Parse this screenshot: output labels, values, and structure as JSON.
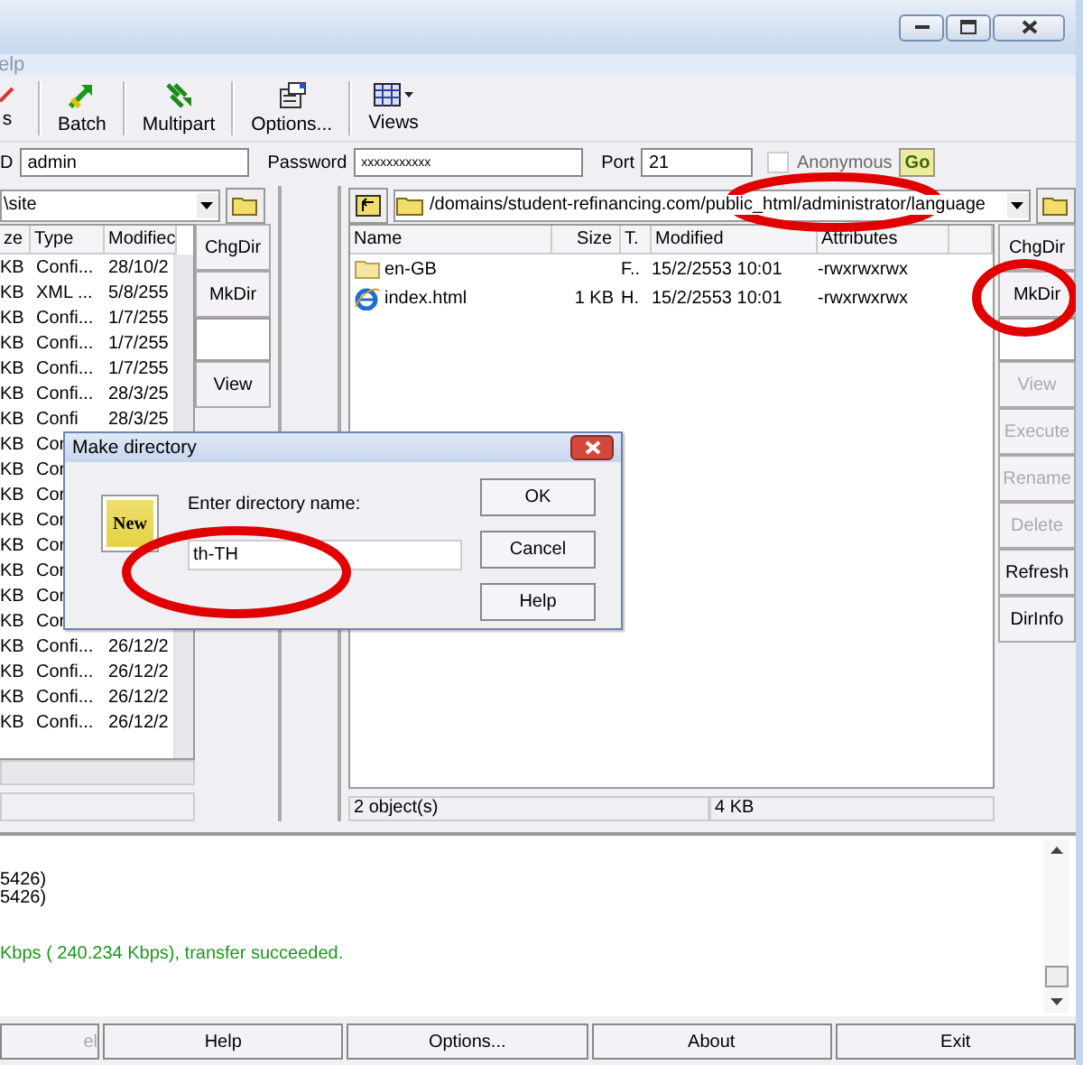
{
  "menu_bar": {
    "items": [
      "elp"
    ]
  },
  "toolbar": [
    {
      "kind": "edit",
      "label": "s"
    },
    {
      "kind": "batch",
      "label": "Batch"
    },
    {
      "kind": "multipart",
      "label": "Multipart"
    },
    {
      "kind": "options",
      "label": "Options..."
    },
    {
      "kind": "views",
      "label": "Views"
    }
  ],
  "connection": {
    "user_label": "D",
    "user": "admin",
    "password_label": "Password",
    "password": "xxxxxxxxxxx",
    "port_label": "Port",
    "port": "21",
    "anonymous": {
      "label": "Anonymous",
      "checked": false,
      "disabled": true
    },
    "go": "Go"
  },
  "local_pane": {
    "path": "\\site",
    "columns": [
      "ze",
      "Type",
      "Modifiec"
    ],
    "rows": [
      {
        "size": "KB",
        "type": "Confi...",
        "modified": "28/10/2"
      },
      {
        "size": "KB",
        "type": "XML ...",
        "modified": "5/8/255"
      },
      {
        "size": "KB",
        "type": "Confi...",
        "modified": "1/7/255"
      },
      {
        "size": "KB",
        "type": "Confi...",
        "modified": "1/7/255"
      },
      {
        "size": "KB",
        "type": "Confi...",
        "modified": "1/7/255"
      },
      {
        "size": "KB",
        "type": "Confi...",
        "modified": "28/3/25"
      },
      {
        "size": "KB",
        "type": "Confi",
        "modified": "28/3/25"
      },
      {
        "size": "KB",
        "type": "Cor"
      },
      {
        "size": "KB",
        "type": "Cor"
      },
      {
        "size": "KB",
        "type": "Cor"
      },
      {
        "size": "KB",
        "type": "Cor"
      },
      {
        "size": "KB",
        "type": "Cor"
      },
      {
        "size": "KB",
        "type": "Cor"
      },
      {
        "size": "KB",
        "type": "Cor"
      },
      {
        "size": "KB",
        "type": "Cor"
      },
      {
        "size": "KB",
        "type": "Confi...",
        "modified": "26/12/2"
      },
      {
        "size": "KB",
        "type": "Confi...",
        "modified": "26/12/2"
      },
      {
        "size": "KB",
        "type": "Confi...",
        "modified": "26/12/2"
      },
      {
        "size": "KB",
        "type": "Confi...",
        "modified": "26/12/2"
      }
    ],
    "buttons": [
      {
        "kind": "button",
        "label": "ChgDir",
        "disabled": false
      },
      {
        "kind": "button",
        "label": "MkDir",
        "disabled": false
      },
      {
        "kind": "blank"
      },
      {
        "kind": "button",
        "label": "View",
        "disabled": false
      }
    ]
  },
  "remote_pane": {
    "path": "/domains/student-refinancing.com/public_html/administrator/language",
    "columns": [
      "Name",
      "Size",
      "T.",
      "Modified",
      "Attributes"
    ],
    "rows": [
      {
        "kind": "folder",
        "name": "en-GB",
        "type": "F..",
        "modified": "15/2/2553 10:01",
        "attributes": "-rwxrwxrwx"
      },
      {
        "kind": "html",
        "name": "index.html",
        "size": "1 KB",
        "type": "H.",
        "modified": "15/2/2553 10:01",
        "attributes": "-rwxrwxrwx"
      }
    ],
    "status": [
      "2 object(s)",
      "4 KB"
    ],
    "buttons": [
      {
        "kind": "button",
        "label": "ChgDir",
        "disabled": false
      },
      {
        "kind": "button",
        "label": "MkDir",
        "disabled": false
      },
      {
        "kind": "blank"
      },
      {
        "kind": "button",
        "label": "View",
        "disabled": true
      },
      {
        "kind": "button",
        "label": "Execute",
        "disabled": true
      },
      {
        "kind": "button",
        "label": "Rename",
        "disabled": true
      },
      {
        "kind": "button",
        "label": "Delete",
        "disabled": true
      },
      {
        "kind": "button",
        "label": "Refresh",
        "disabled": false
      },
      {
        "kind": "button",
        "label": "DirInfo",
        "disabled": false
      }
    ]
  },
  "log": [
    {
      "kind": "info",
      "text": "5426)"
    },
    {
      "kind": "info",
      "text": "5426)"
    },
    {
      "kind": "success",
      "text": "Kbps ( 240.234 Kbps), transfer succeeded."
    }
  ],
  "bottom_buttons": [
    {
      "label": "el",
      "disabled": true
    },
    {
      "label": "Help",
      "disabled": false
    },
    {
      "label": "Options...",
      "disabled": false
    },
    {
      "label": "About",
      "disabled": false
    },
    {
      "label": "Exit",
      "disabled": false
    }
  ],
  "dialog": {
    "title": "Make directory",
    "icon_label": "New",
    "prompt": "Enter directory name:",
    "value": "th-TH",
    "buttons": [
      "OK",
      "Cancel",
      "Help"
    ]
  }
}
